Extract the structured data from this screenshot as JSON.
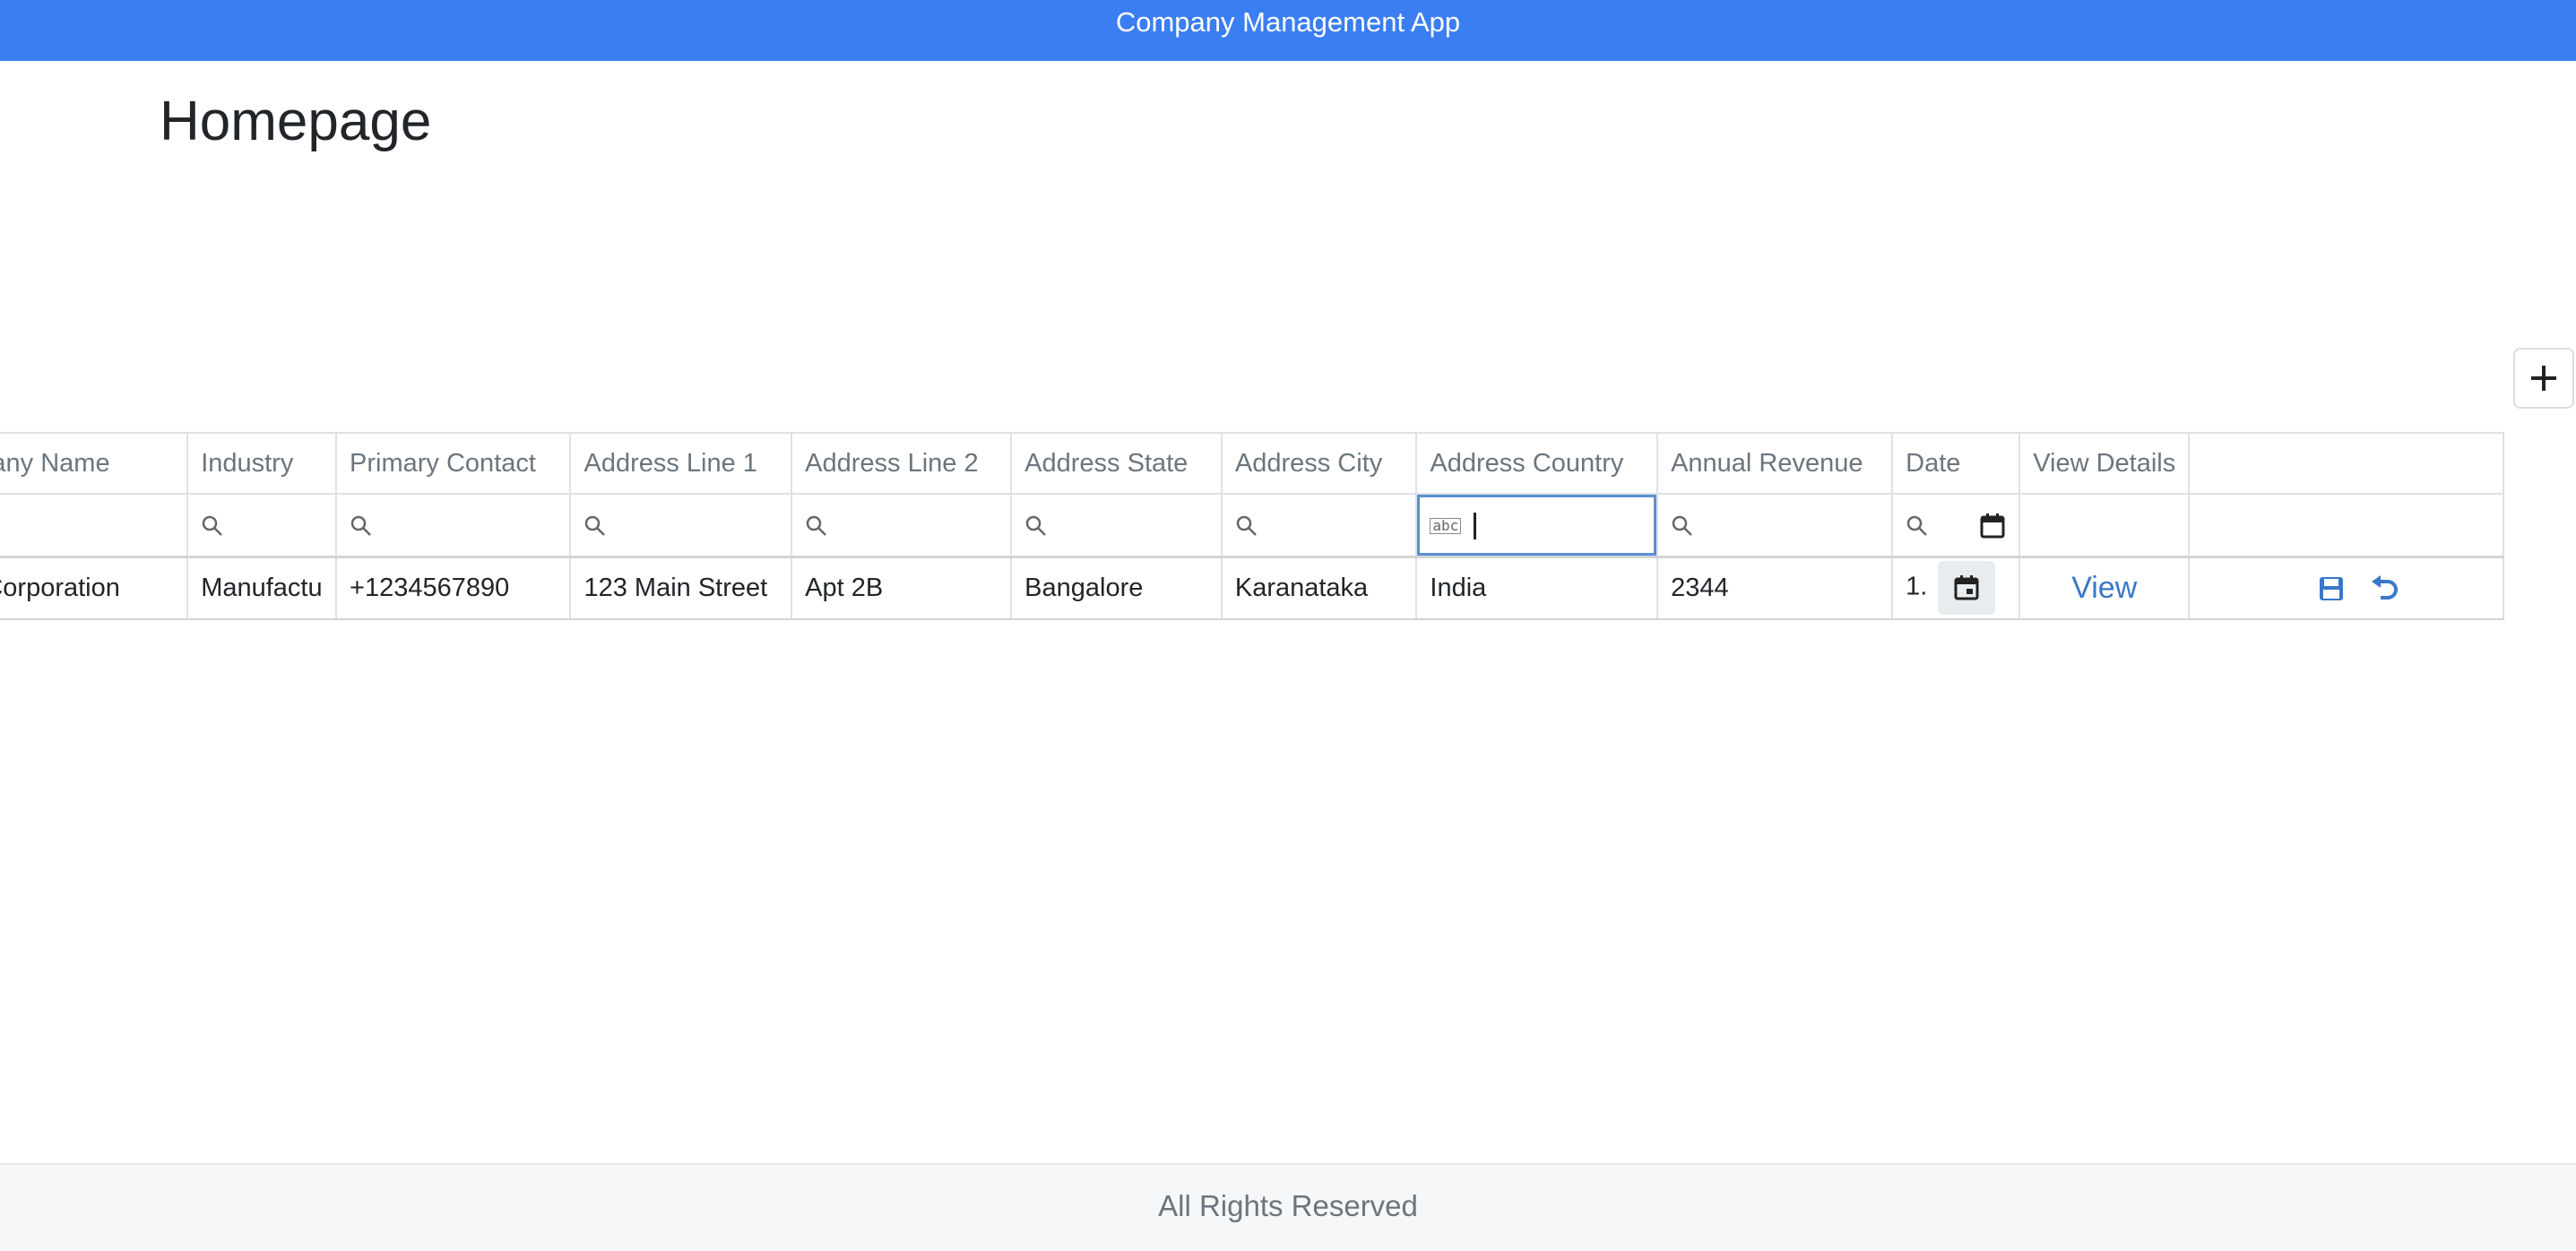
{
  "app": {
    "title": "Company Management App"
  },
  "page": {
    "title": "Homepage"
  },
  "toolbar": {
    "add_label": "+"
  },
  "grid": {
    "columns": [
      "ompany Name",
      "Industry",
      "Primary Contact",
      "Address Line 1",
      "Address Line 2",
      "Address State",
      "Address City",
      "Address Country",
      "Annual Revenue",
      "Date",
      "View Details",
      ""
    ],
    "rows": [
      {
        "company_name": "BC Corporation",
        "industry": "Manufactu",
        "primary_contact": "+1234567890",
        "address_line1": "123 Main Street",
        "address_line2": "Apt 2B",
        "address_state": "Bangalore",
        "address_city": "Karanataka",
        "address_country": "India",
        "annual_revenue": "2344",
        "date": "1.",
        "view_label": "View"
      }
    ],
    "filter_country_value": ""
  },
  "icons": {
    "search": "search-icon",
    "calendar": "calendar-icon",
    "save": "save-icon",
    "undo": "undo-icon",
    "add": "plus-icon"
  },
  "colors": {
    "topbar": "#3a7ef2",
    "link": "#3a78c9",
    "focus": "#5b8fd1"
  },
  "footer": {
    "text": "All Rights Reserved"
  }
}
